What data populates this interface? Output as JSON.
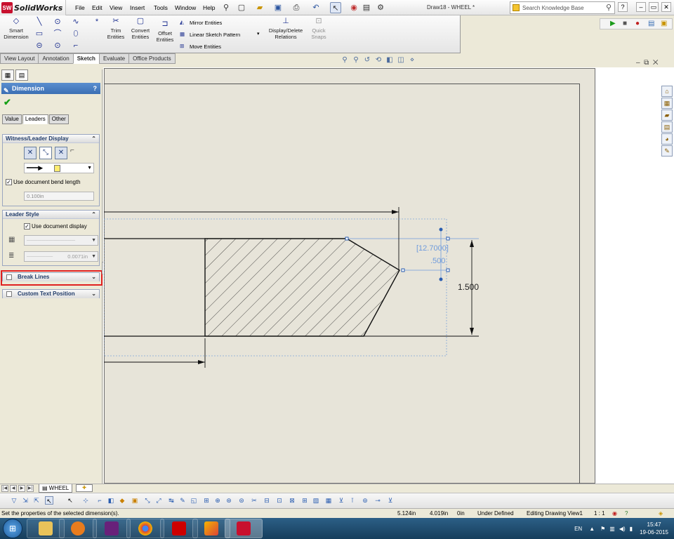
{
  "app": {
    "name": "SolidWorks",
    "logo_text": "SW",
    "document_title": "Draw18 - WHEEL *"
  },
  "menu": [
    "File",
    "Edit",
    "View",
    "Insert",
    "Tools",
    "Window",
    "Help"
  ],
  "search": {
    "placeholder": "Search Knowledge Base"
  },
  "command_manager": {
    "smart_dimension": "Smart Dimension",
    "trim_entities": "Trim Entities",
    "convert_entities": "Convert Entities",
    "offset_entities": "Offset Entities",
    "mirror_entities": "Mirror Entities",
    "linear_sketch_pattern": "Linear Sketch Pattern",
    "move_entities": "Move Entities",
    "display_delete_relations": "Display/Delete Relations",
    "quick_snaps": "Quick Snaps"
  },
  "tabs": [
    "View Layout",
    "Annotation",
    "Sketch",
    "Evaluate",
    "Office Products"
  ],
  "active_tab": "Sketch",
  "property_manager": {
    "title": "Dimension",
    "help": "?",
    "subtabs": [
      "Value",
      "Leaders",
      "Other"
    ],
    "active_subtab": "Leaders",
    "witness_group": "Witness/Leader Display",
    "use_doc_bend_length": "Use document bend length",
    "bend_length_value": "0.100in",
    "leader_style_group": "Leader Style",
    "use_document_display": "Use document display",
    "thickness_value": "0.0071in",
    "break_lines": "Break Lines",
    "custom_text_position": "Custom Text Position"
  },
  "drawing": {
    "dimension_mm": "[12.7000]",
    "dimension_in": ".500",
    "dimension_height": "1.500"
  },
  "sheet_tab": "WHEEL",
  "status": {
    "message": "Set the properties of the selected dimension(s).",
    "x": "5.124in",
    "y": "4.019in",
    "z": "0in",
    "state": "Under Defined",
    "editing": "Editing Drawing View1",
    "scale": "1 : 1"
  },
  "taskbar": {
    "lang": "EN",
    "time": "15:47",
    "date": "19-06-2015"
  }
}
